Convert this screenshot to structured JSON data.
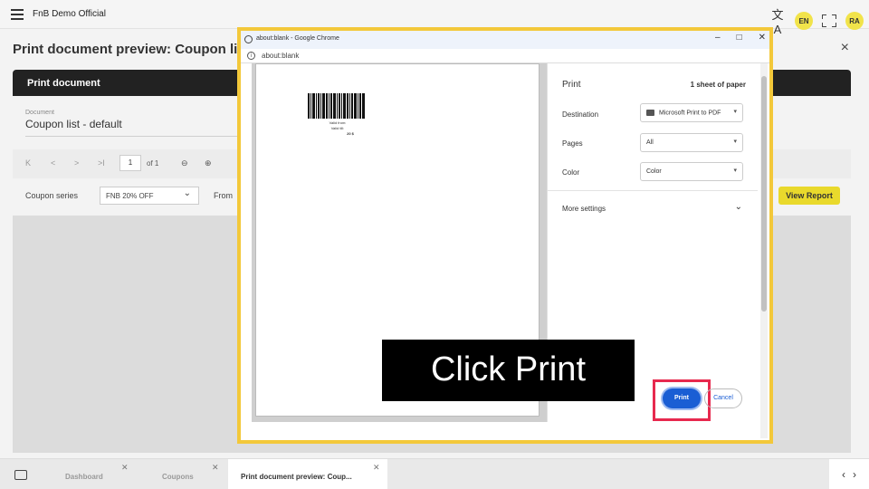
{
  "app": {
    "title": "FnB Demo Official",
    "lang": "EN",
    "avatar": "RA",
    "translate_icon": "文A"
  },
  "page": {
    "title": "Print document preview: Coupon list",
    "close": "×",
    "panel_title": "Print document",
    "document_label": "Document",
    "document_value": "Coupon list - default",
    "pager": {
      "page": "1",
      "of": "of 1"
    },
    "filters": {
      "coupon_series_label": "Coupon series",
      "coupon_series_value": "FNB 20% OFF",
      "from_label": "From"
    },
    "view_report": "View Report"
  },
  "tabs": [
    {
      "label": "Dashboard"
    },
    {
      "label": "Coupons"
    },
    {
      "label": "Print document preview: Coup..."
    }
  ],
  "tab_nav": {
    "prev": "‹",
    "next": "›"
  },
  "chrome": {
    "window_title": "about:blank - Google Chrome",
    "url": "about:blank",
    "controls": {
      "minimize": "–",
      "maximize": "□",
      "close": "✕"
    }
  },
  "preview": {
    "valid_from": "Valid from:",
    "valid_till": "Valid till:",
    "amount": "20 $"
  },
  "print_settings": {
    "title": "Print",
    "sheets": "1 sheet of paper",
    "destination_label": "Destination",
    "destination_value": "Microsoft Print to PDF",
    "pages_label": "Pages",
    "pages_value": "All",
    "color_label": "Color",
    "color_value": "Color",
    "more_settings": "More settings",
    "print_button": "Print",
    "cancel_button": "Cancel"
  },
  "caption": "Click Print",
  "colors": {
    "highlight_frame": "#f3c83a",
    "print_highlight": "#e7294e",
    "print_button": "#1a5ed4",
    "view_report": "#e9d92c"
  }
}
